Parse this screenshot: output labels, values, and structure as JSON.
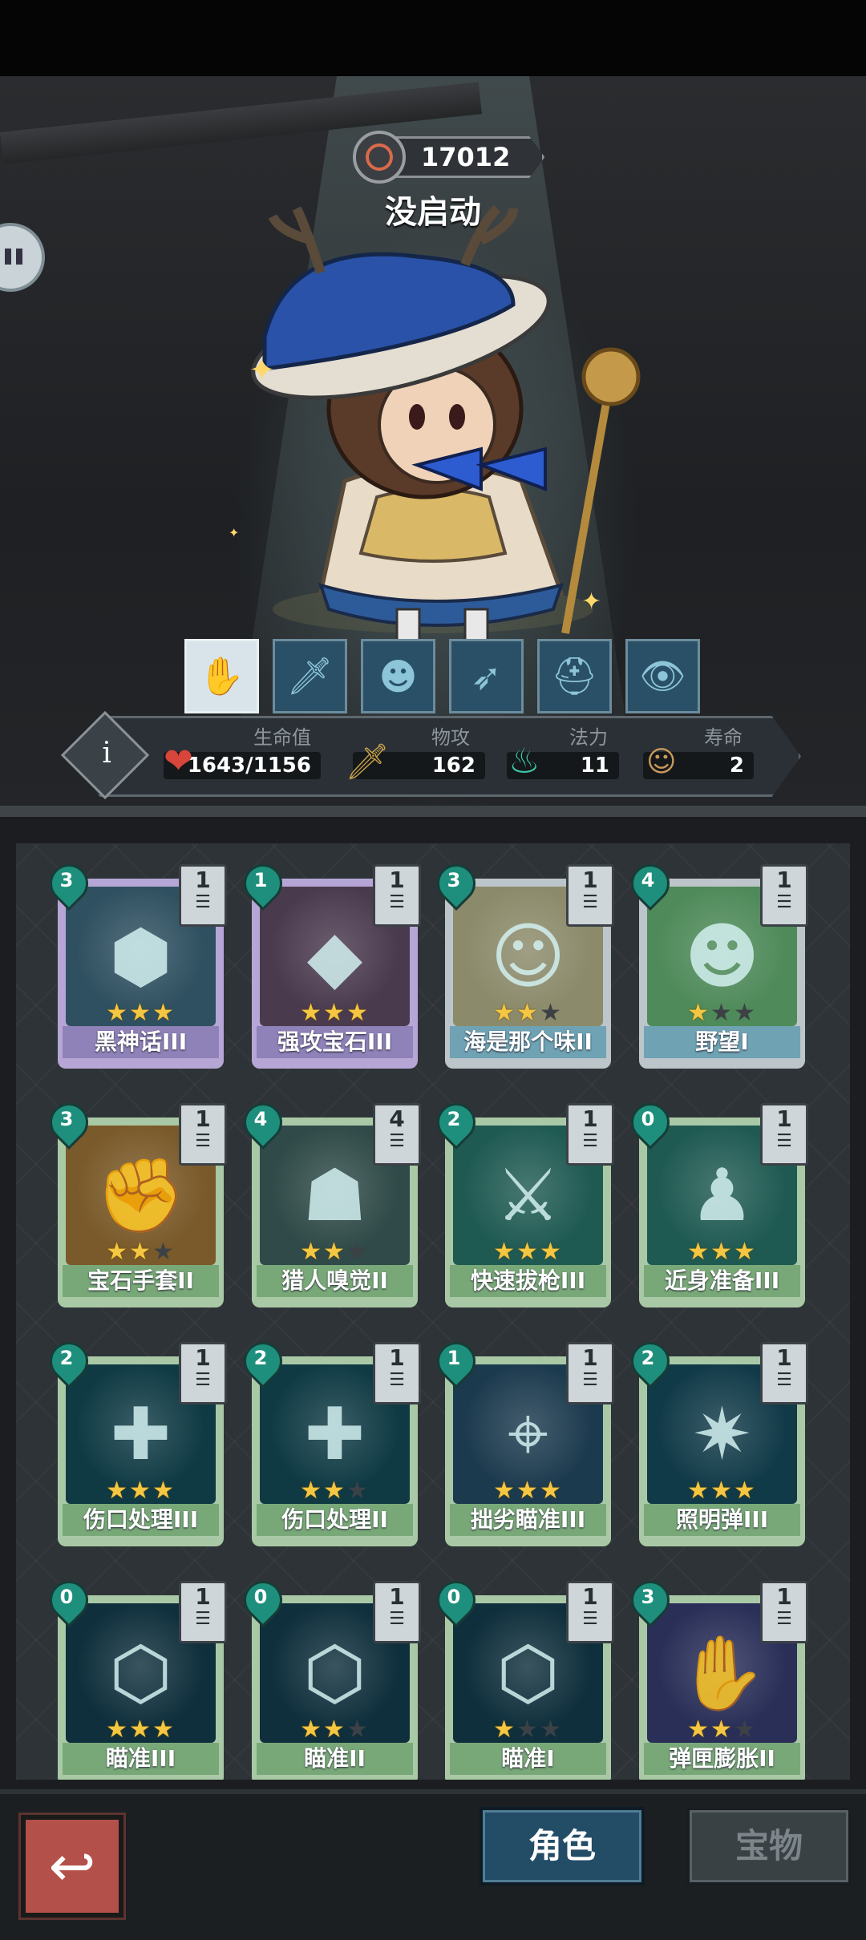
{
  "header": {
    "power": "17012",
    "status": "没启动"
  },
  "skills": [
    {
      "icon": "hand-sparkle-icon",
      "glyph": "✋",
      "active": true
    },
    {
      "icon": "dagger-icon",
      "glyph": "🗡",
      "active": false
    },
    {
      "icon": "frog-mask-icon",
      "glyph": "☻",
      "active": false
    },
    {
      "icon": "bow-icon",
      "glyph": "➶",
      "active": false
    },
    {
      "icon": "helmet-icon",
      "glyph": "⛑",
      "active": false
    },
    {
      "icon": "eye-drip-icon",
      "glyph": "👁",
      "active": false
    }
  ],
  "stats": {
    "hp_label": "生命值",
    "hp_value": "1643/1156",
    "atk_label": "物攻",
    "atk_value": "162",
    "mana_label": "法力",
    "mana_value": "11",
    "life_label": "寿命",
    "life_value": "2"
  },
  "cards": [
    {
      "name": "黑神话III",
      "cost": "3",
      "level": "1",
      "stars": 3,
      "theme": "purple",
      "bg": "#2f5060",
      "glyph": "⬢"
    },
    {
      "name": "强攻宝石III",
      "cost": "1",
      "level": "1",
      "stars": 3,
      "theme": "purple",
      "bg": "#4a3a4e",
      "glyph": "◆"
    },
    {
      "name": "海是那个味II",
      "cost": "3",
      "level": "1",
      "stars": 2,
      "theme": "blue",
      "bg": "#8b8a6a",
      "glyph": "☺"
    },
    {
      "name": "野望I",
      "cost": "4",
      "level": "1",
      "stars": 1,
      "theme": "blue",
      "bg": "#4f8a5a",
      "glyph": "☻"
    },
    {
      "name": "宝石手套II",
      "cost": "3",
      "level": "1",
      "stars": 2,
      "theme": "green",
      "bg": "#7a5a2a",
      "glyph": "✊"
    },
    {
      "name": "猎人嗅觉II",
      "cost": "4",
      "level": "4",
      "stars": 2,
      "theme": "green",
      "bg": "#2f4a48",
      "glyph": "☗"
    },
    {
      "name": "快速拔枪III",
      "cost": "2",
      "level": "1",
      "stars": 3,
      "theme": "green",
      "bg": "#1f5a52",
      "glyph": "⚔"
    },
    {
      "name": "近身准备III",
      "cost": "0",
      "level": "1",
      "stars": 3,
      "theme": "green",
      "bg": "#1f5a52",
      "glyph": "♟"
    },
    {
      "name": "伤口处理III",
      "cost": "2",
      "level": "1",
      "stars": 3,
      "theme": "green",
      "bg": "#0f3a44",
      "glyph": "✚"
    },
    {
      "name": "伤口处理II",
      "cost": "2",
      "level": "1",
      "stars": 2,
      "theme": "green",
      "bg": "#0f3a44",
      "glyph": "✚"
    },
    {
      "name": "拙劣瞄准III",
      "cost": "1",
      "level": "1",
      "stars": 3,
      "theme": "green",
      "bg": "#1c3a4e",
      "glyph": "⌖"
    },
    {
      "name": "照明弹III",
      "cost": "2",
      "level": "1",
      "stars": 3,
      "theme": "green",
      "bg": "#113a48",
      "glyph": "✷"
    },
    {
      "name": "瞄准III",
      "cost": "0",
      "level": "1",
      "stars": 3,
      "theme": "green",
      "bg": "#0f2f3c",
      "glyph": "⬡"
    },
    {
      "name": "瞄准II",
      "cost": "0",
      "level": "1",
      "stars": 2,
      "theme": "green",
      "bg": "#0f2f3c",
      "glyph": "⬡"
    },
    {
      "name": "瞄准I",
      "cost": "0",
      "level": "1",
      "stars": 1,
      "theme": "green",
      "bg": "#0f2f3c",
      "glyph": "⬡"
    },
    {
      "name": "弹匣膨胀II",
      "cost": "3",
      "level": "1",
      "stars": 2,
      "theme": "green",
      "bg": "#2a2f58",
      "glyph": "✋"
    }
  ],
  "nav": {
    "back_glyph": "↩",
    "role_tab": "角色",
    "treasure_tab": "宝物"
  },
  "colors": {
    "accent": "#234c66",
    "star": "#f4c642",
    "back_button": "#b4504a"
  }
}
